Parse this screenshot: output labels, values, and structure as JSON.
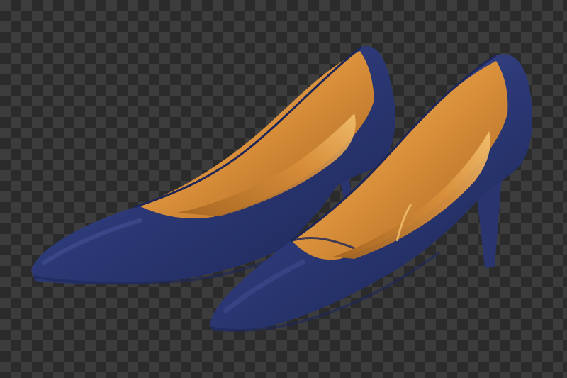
{
  "image": {
    "subject": "pair-of-navy-pointed-toe-pumps",
    "background": "transparency-checkerboard",
    "colors": {
      "checker_dark": "#2b2b2b",
      "checker_light": "#3c3c3c",
      "leather_base": "#2d3a78",
      "leather_dark": "#1d2656",
      "leather_highlight": "#5361a8",
      "lining": "#d98f3a",
      "lining_shadow": "#a4641f",
      "lining_highlight": "#f2c06f",
      "heel": "#2a3570"
    },
    "items": [
      {
        "name": "back-shoe",
        "role": "left-rear"
      },
      {
        "name": "front-shoe",
        "role": "right-front"
      }
    ]
  }
}
